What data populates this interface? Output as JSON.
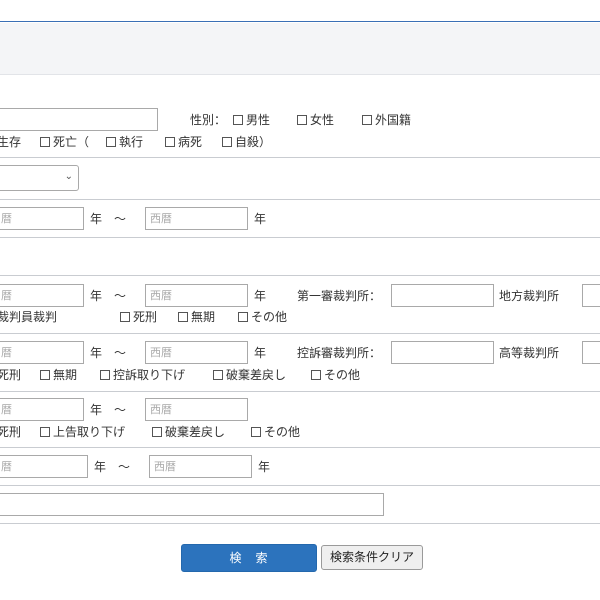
{
  "form": {
    "name_value": "",
    "gender_label": "性別：",
    "gender_male": "男性",
    "gender_female": "女性",
    "foreign_label": "外国籍",
    "status_alive_partial": "生存",
    "status_dead": "死亡（",
    "status_executed": "執行",
    "status_illness": "病死",
    "status_suicide": "自殺）",
    "select_value": "",
    "era_placeholder_partial": "暦",
    "era_placeholder": "西暦",
    "year_label": "年",
    "tilde": "～",
    "first_court_label": "第一審裁判所：",
    "district_court": "地方裁判所",
    "lay_judge_partial": "裁判員裁判",
    "death_penalty": "死刑",
    "life_imprisonment": "無期",
    "other": "その他",
    "appeal_court_label": "控訴審裁判所：",
    "high_court": "高等裁判所",
    "appeal_withdrawn": "控訴取り下げ",
    "reversal_remand": "破棄差戻し",
    "final_appeal_withdrawn": "上告取り下げ",
    "free_text_value": ""
  },
  "buttons": {
    "search": "検　索",
    "clear": "検索条件クリア"
  }
}
